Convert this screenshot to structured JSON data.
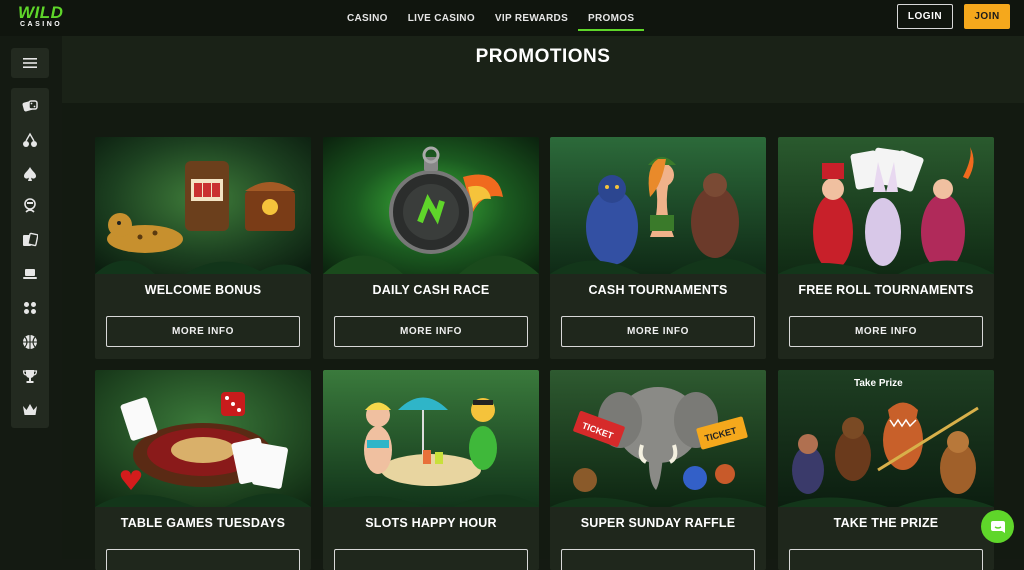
{
  "header": {
    "logo_top": "WILD",
    "logo_bottom": "CASINO",
    "nav": [
      {
        "label": "CASINO"
      },
      {
        "label": "LIVE CASINO"
      },
      {
        "label": "VIP REWARDS"
      },
      {
        "label": "PROMOS"
      }
    ],
    "login_label": "LOGIN",
    "join_label": "JOIN"
  },
  "page": {
    "title": "PROMOTIONS"
  },
  "promos": [
    {
      "title": "WELCOME BONUS",
      "button": "MORE INFO"
    },
    {
      "title": "DAILY CASH RACE",
      "button": "MORE INFO"
    },
    {
      "title": "CASH TOURNAMENTS",
      "button": "MORE INFO"
    },
    {
      "title": "FREE ROLL TOURNAMENTS",
      "button": "MORE INFO"
    },
    {
      "title": "TABLE GAMES TUESDAYS",
      "button": ""
    },
    {
      "title": "SLOTS HAPPY HOUR",
      "button": ""
    },
    {
      "title": "SUPER SUNDAY RAFFLE",
      "button": ""
    },
    {
      "title": "TAKE THE PRIZE",
      "button": ""
    }
  ],
  "promo_art": {
    "takeprize_logo": "Take Prize",
    "ticket_text": "TICKET"
  },
  "colors": {
    "brand_green": "#5fd62a",
    "join_orange": "#f5a81c",
    "background": "#131a11",
    "card": "#1f271c"
  },
  "icons": [
    "menu-icon",
    "casino-dice-icon",
    "cherry-icon",
    "spade-icon",
    "live-dealer-icon",
    "cards-icon",
    "laptop-icon",
    "dice-icon",
    "basketball-icon",
    "trophy-icon",
    "crown-icon",
    "chat-icon"
  ]
}
